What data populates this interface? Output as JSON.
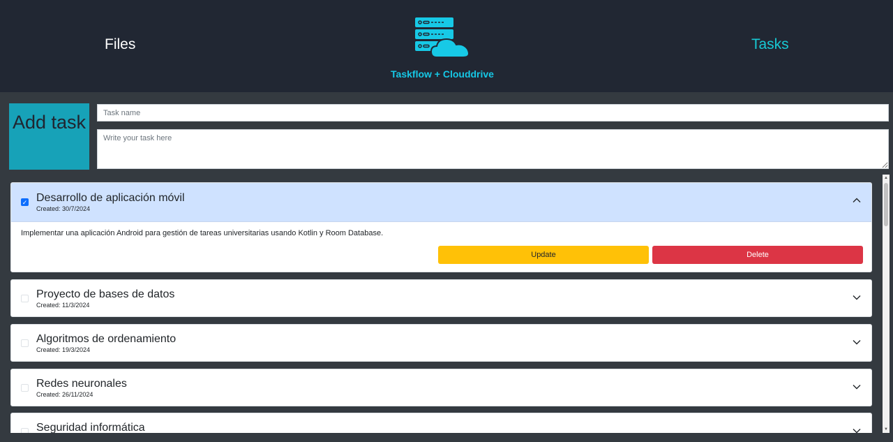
{
  "header": {
    "nav_files": "Files",
    "nav_tasks": "Tasks",
    "brand": "Taskflow + Clouddrive",
    "accent": "#17c9d4"
  },
  "form": {
    "add_label": "Add task",
    "task_name_placeholder": "Task name",
    "task_desc_placeholder": "Write your task here"
  },
  "tasks": [
    {
      "title": "Desarrollo de aplicación móvil",
      "created": "Created: 30/7/2024",
      "checked": true,
      "expanded": true,
      "description": "Implementar una aplicación Android para gestión de tareas universitarias usando Kotlin y Room Database.",
      "update_label": "Update",
      "delete_label": "Delete"
    },
    {
      "title": "Proyecto de bases de datos",
      "created": "Created: 11/3/2024",
      "checked": false,
      "expanded": false
    },
    {
      "title": "Algoritmos de ordenamiento",
      "created": "Created: 19/3/2024",
      "checked": false,
      "expanded": false
    },
    {
      "title": "Redes neuronales",
      "created": "Created: 26/11/2024",
      "checked": false,
      "expanded": false
    },
    {
      "title": "Seguridad informática",
      "created": "",
      "checked": false,
      "expanded": false
    }
  ],
  "icons": {
    "logo": "server-cloud-icon",
    "chevron_open": "chevron-up-icon",
    "chevron_closed": "chevron-down-icon"
  }
}
